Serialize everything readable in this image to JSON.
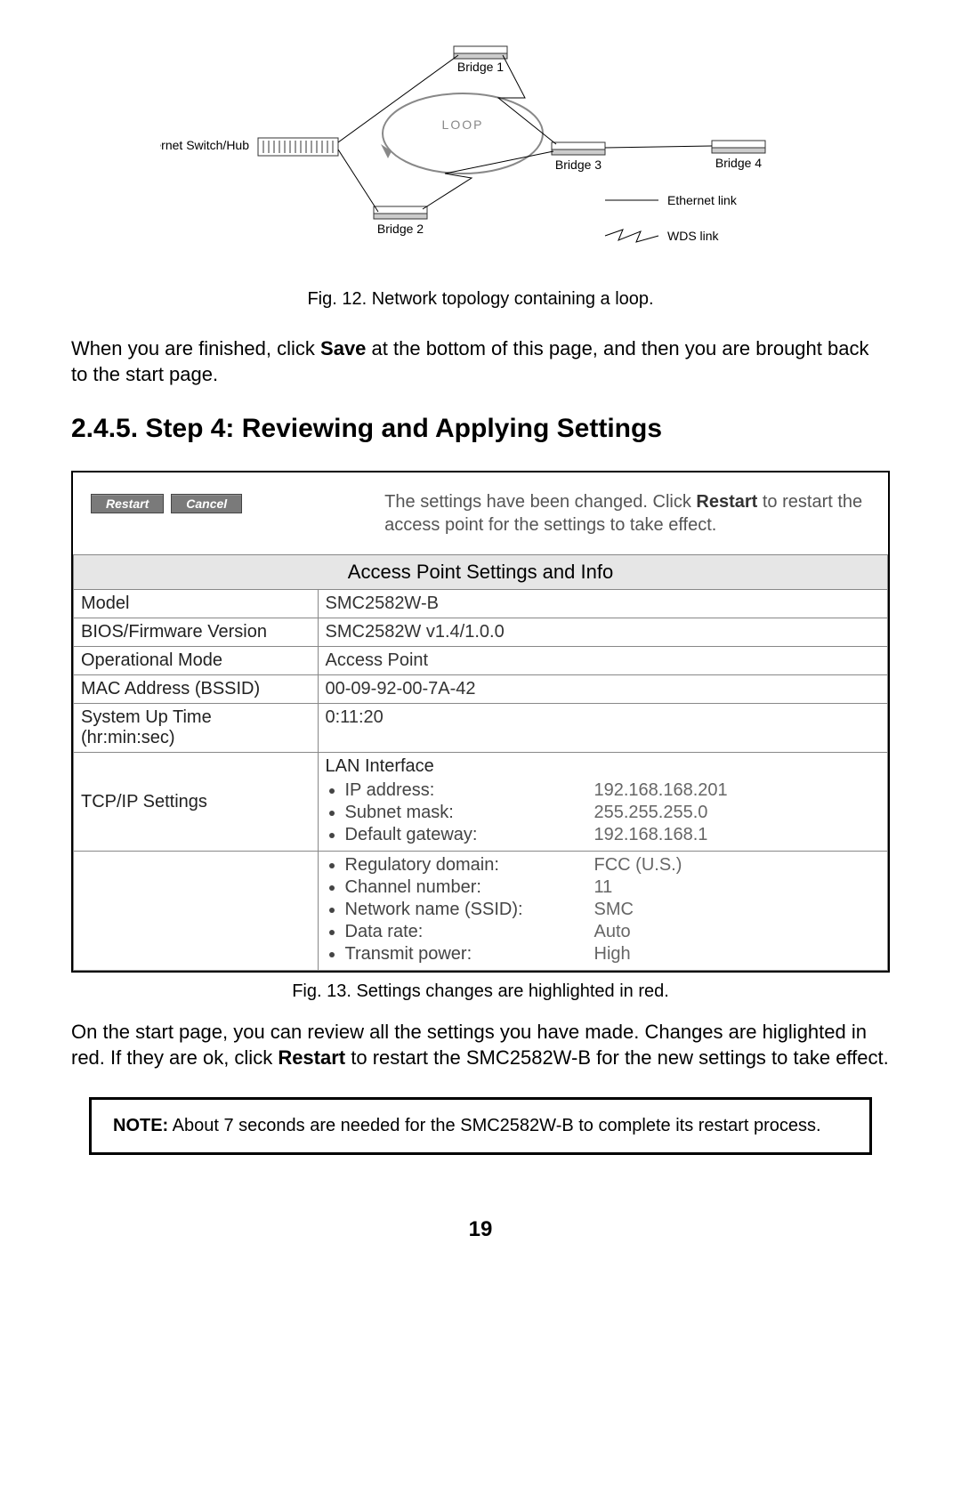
{
  "diagram": {
    "switch_label": "Ethernet Switch/Hub",
    "loop_label": "LOOP",
    "bridge1": "Bridge 1",
    "bridge2": "Bridge 2",
    "bridge3": "Bridge 3",
    "bridge4": "Bridge 4",
    "eth_link": "Ethernet link",
    "wds_link": "WDS link"
  },
  "fig12_caption": "Fig. 12. Network topology containing a loop.",
  "para1_prefix": "When you are finished, click ",
  "para1_bold": "Save",
  "para1_suffix": " at the bottom of this page, and then you are brought back to the start page.",
  "section_heading": "2.4.5. Step 4: Reviewing and Applying Settings",
  "top_message": {
    "line1": "The settings have been changed. Click ",
    "restart_word": "Restart",
    "line2": " to restart the access point for the settings to take effect."
  },
  "buttons": {
    "restart": "Restart",
    "cancel": "Cancel"
  },
  "table": {
    "group_header": "Access Point Settings and Info",
    "rows": {
      "model_label": "Model",
      "model_value": "SMC2582W-B",
      "bios_label": "BIOS/Firmware Version",
      "bios_value": "SMC2582W v1.4/1.0.0",
      "opmode_label": "Operational Mode",
      "opmode_value": "Access Point",
      "mac_label": "MAC Address (BSSID)",
      "mac_value": "00-09-92-00-7A-42",
      "uptime_label": "System Up Time (hr:min:sec)",
      "uptime_value": "0:11:20",
      "tcpip_label": "TCP/IP Settings",
      "lan_heading": "LAN Interface",
      "ip_k": "IP address:",
      "ip_v": "192.168.168.201",
      "subnet_k": "Subnet mask:",
      "subnet_v": "255.255.255.0",
      "gw_k": "Default gateway:",
      "gw_v": "192.168.168.1",
      "reg_k": "Regulatory domain:",
      "reg_v": "FCC (U.S.)",
      "chan_k": "Channel number:",
      "chan_v": "11",
      "ssid_k": "Network name (SSID):",
      "ssid_v": "SMC",
      "rate_k": "Data rate:",
      "rate_v": "Auto",
      "tx_k": "Transmit power:",
      "tx_v": "High"
    }
  },
  "fig13_caption": "Fig. 13. Settings changes are highlighted in red.",
  "para2_prefix": "On the start page, you can review all the settings you have made.  Changes are higlighted in red. If they are ok, click ",
  "para2_bold": "Restart",
  "para2_suffix": " to restart the SMC2582W-B for the new settings to take effect.",
  "note_label": "NOTE:",
  "note_text": " About 7 seconds are needed for the SMC2582W-B to complete its restart process.",
  "page_number": "19"
}
